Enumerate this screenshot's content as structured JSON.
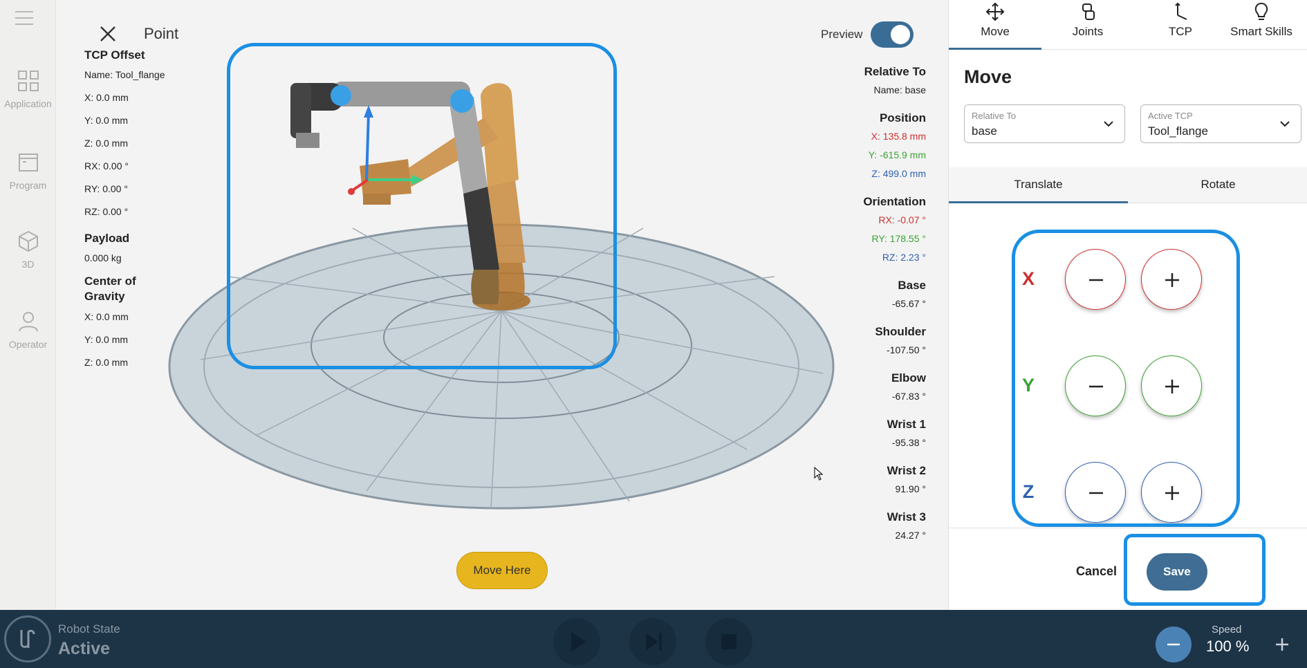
{
  "sidebar": {
    "items": [
      {
        "label": "Application",
        "icon": "grid-icon"
      },
      {
        "label": "Program",
        "icon": "program-icon"
      },
      {
        "label": "3D",
        "icon": "cube-icon"
      },
      {
        "label": "Operator",
        "icon": "person-icon"
      }
    ]
  },
  "header": {
    "title": "Point",
    "preview_label": "Preview",
    "preview_on": true
  },
  "tcp_info": {
    "tcp_offset_heading": "TCP Offset",
    "name": "Name: Tool_flange",
    "x": "X: 0.0 mm",
    "y": "Y: 0.0 mm",
    "z": "Z: 0.0 mm",
    "rx": "RX: 0.00 °",
    "ry": "RY: 0.00 °",
    "rz": "RZ: 0.00 °",
    "payload_heading": "Payload",
    "payload": "0.000 kg",
    "cog_heading": "Center of Gravity",
    "cog_x": "X: 0.0 mm",
    "cog_y": "Y: 0.0 mm",
    "cog_z": "Z: 0.0 mm"
  },
  "pose_info": {
    "relative_heading": "Relative To",
    "relative_name": "Name: base",
    "position_heading": "Position",
    "pos_x": "X: 135.8 mm",
    "pos_y": "Y: -615.9 mm",
    "pos_z": "Z: 499.0 mm",
    "orientation_heading": "Orientation",
    "rx": "RX: -0.07 °",
    "ry": "RY: 178.55 °",
    "rz": "RZ: 2.23 °",
    "joints": [
      {
        "name": "Base",
        "value": "-65.67 °"
      },
      {
        "name": "Shoulder",
        "value": "-107.50 °"
      },
      {
        "name": "Elbow",
        "value": "-67.83 °"
      },
      {
        "name": "Wrist 1",
        "value": "-95.38 °"
      },
      {
        "name": "Wrist 2",
        "value": "91.90 °"
      },
      {
        "name": "Wrist 3",
        "value": "24.27 °"
      }
    ]
  },
  "move_here_label": "Move Here",
  "panel": {
    "tabs": [
      {
        "label": "Move",
        "icon": "move-arrows-icon"
      },
      {
        "label": "Joints",
        "icon": "joints-icon"
      },
      {
        "label": "TCP",
        "icon": "tcp-icon"
      },
      {
        "label": "Smart Skills",
        "icon": "lightbulb-icon"
      }
    ],
    "title": "Move",
    "relative_to": {
      "caption": "Relative To",
      "value": "base"
    },
    "active_tcp": {
      "caption": "Active TCP",
      "value": "Tool_flange"
    },
    "subtabs": [
      "Translate",
      "Rotate"
    ],
    "axes": [
      {
        "label": "X",
        "color": "#cc2e2e"
      },
      {
        "label": "Y",
        "color": "#3aa233"
      },
      {
        "label": "Z",
        "color": "#2e5fb0"
      }
    ],
    "cancel_label": "Cancel",
    "save_label": "Save"
  },
  "footer": {
    "state_caption": "Robot State",
    "state_value": "Active",
    "speed_caption": "Speed",
    "speed_value": "100 %"
  },
  "colors": {
    "accent": "#3a6d96",
    "highlight": "#1a8fe3",
    "move_here": "#e7b51d",
    "bottom_bar": "#1d3447"
  }
}
